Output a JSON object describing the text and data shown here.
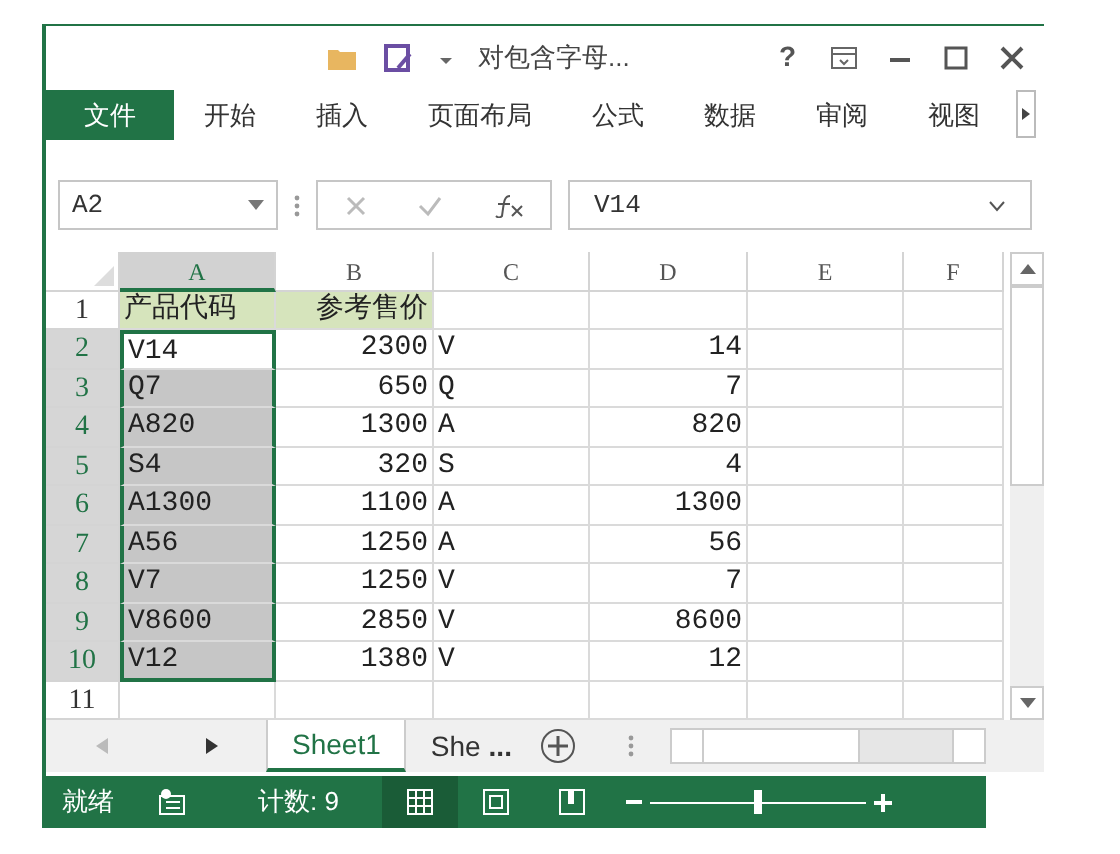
{
  "window": {
    "title": "对包含字母...",
    "buttons": [
      "?"
    ]
  },
  "ribbon_tabs": [
    {
      "label": "文件",
      "selected": true
    },
    {
      "label": "开始",
      "selected": false
    },
    {
      "label": "插入",
      "selected": false
    },
    {
      "label": "页面布局",
      "selected": false
    },
    {
      "label": "公式",
      "selected": false
    },
    {
      "label": "数据",
      "selected": false
    },
    {
      "label": "审阅",
      "selected": false
    },
    {
      "label": "视图",
      "selected": false
    }
  ],
  "formula_bar": {
    "name_box": "A2",
    "formula": "V14"
  },
  "columns": [
    {
      "label": "A",
      "selected": true
    },
    {
      "label": "B",
      "selected": false
    },
    {
      "label": "C",
      "selected": false
    },
    {
      "label": "D",
      "selected": false
    },
    {
      "label": "E",
      "selected": false
    },
    {
      "label": "F",
      "selected": false
    }
  ],
  "rows": [
    {
      "label": "1",
      "selected": false,
      "cells": [
        {
          "text": "产品代码",
          "highlighted": true,
          "selected": false
        },
        {
          "text": "参考售价",
          "highlighted": true,
          "selected": false
        },
        {
          "text": "",
          "highlighted": false,
          "selected": false
        },
        {
          "text": "",
          "highlighted": false,
          "selected": false
        }
      ]
    },
    {
      "label": "2",
      "selected": true,
      "cells": [
        {
          "text": "V14",
          "highlighted": false,
          "selected": false
        },
        {
          "text": "2300",
          "highlighted": false,
          "selected": false
        },
        {
          "text": "V",
          "highlighted": false,
          "selected": false
        },
        {
          "text": "14",
          "highlighted": false,
          "selected": false
        }
      ]
    },
    {
      "label": "3",
      "selected": true,
      "cells": [
        {
          "text": "Q7",
          "highlighted": false,
          "selected": true
        },
        {
          "text": "650",
          "highlighted": false,
          "selected": false
        },
        {
          "text": "Q",
          "highlighted": false,
          "selected": false
        },
        {
          "text": "7",
          "highlighted": false,
          "selected": false
        }
      ]
    },
    {
      "label": "4",
      "selected": true,
      "cells": [
        {
          "text": "A820",
          "highlighted": false,
          "selected": true
        },
        {
          "text": "1300",
          "highlighted": false,
          "selected": false
        },
        {
          "text": "A",
          "highlighted": false,
          "selected": false
        },
        {
          "text": "820",
          "highlighted": false,
          "selected": false
        }
      ]
    },
    {
      "label": "5",
      "selected": true,
      "cells": [
        {
          "text": "S4",
          "highlighted": false,
          "selected": true
        },
        {
          "text": "320",
          "highlighted": false,
          "selected": false
        },
        {
          "text": "S",
          "highlighted": false,
          "selected": false
        },
        {
          "text": "4",
          "highlighted": false,
          "selected": false
        }
      ]
    },
    {
      "label": "6",
      "selected": true,
      "cells": [
        {
          "text": "A1300",
          "highlighted": false,
          "selected": true
        },
        {
          "text": "1100",
          "highlighted": false,
          "selected": false
        },
        {
          "text": "A",
          "highlighted": false,
          "selected": false
        },
        {
          "text": "1300",
          "highlighted": false,
          "selected": false
        }
      ]
    },
    {
      "label": "7",
      "selected": true,
      "cells": [
        {
          "text": "A56",
          "highlighted": false,
          "selected": true
        },
        {
          "text": "1250",
          "highlighted": false,
          "selected": false
        },
        {
          "text": "A",
          "highlighted": false,
          "selected": false
        },
        {
          "text": "56",
          "highlighted": false,
          "selected": false
        }
      ]
    },
    {
      "label": "8",
      "selected": true,
      "cells": [
        {
          "text": "V7",
          "highlighted": false,
          "selected": true
        },
        {
          "text": "1250",
          "highlighted": false,
          "selected": false
        },
        {
          "text": "V",
          "highlighted": false,
          "selected": false
        },
        {
          "text": "7",
          "highlighted": false,
          "selected": false
        }
      ]
    },
    {
      "label": "9",
      "selected": true,
      "cells": [
        {
          "text": "V8600",
          "highlighted": false,
          "selected": true
        },
        {
          "text": "2850",
          "highlighted": false,
          "selected": false
        },
        {
          "text": "V",
          "highlighted": false,
          "selected": false
        },
        {
          "text": "8600",
          "highlighted": false,
          "selected": false
        }
      ]
    },
    {
      "label": "10",
      "selected": true,
      "cells": [
        {
          "text": "V12",
          "highlighted": false,
          "selected": true
        },
        {
          "text": "1380",
          "highlighted": false,
          "selected": false
        },
        {
          "text": "V",
          "highlighted": false,
          "selected": false
        },
        {
          "text": "12",
          "highlighted": false,
          "selected": false
        }
      ]
    },
    {
      "label": "11",
      "selected": false,
      "cells": []
    }
  ],
  "sheet_tabs": [
    {
      "label": "Sheet1",
      "selected": true
    },
    {
      "label": "She",
      "selected": false
    }
  ],
  "sheet_tabs_overflow": "...",
  "status_bar": {
    "ready": "就绪",
    "count": "计数: 9",
    "views": [
      {
        "kind": "normal",
        "selected": true
      },
      {
        "kind": "layout",
        "selected": false
      },
      {
        "kind": "break",
        "selected": false
      }
    ],
    "zoom": {
      "level": 0.5
    }
  }
}
